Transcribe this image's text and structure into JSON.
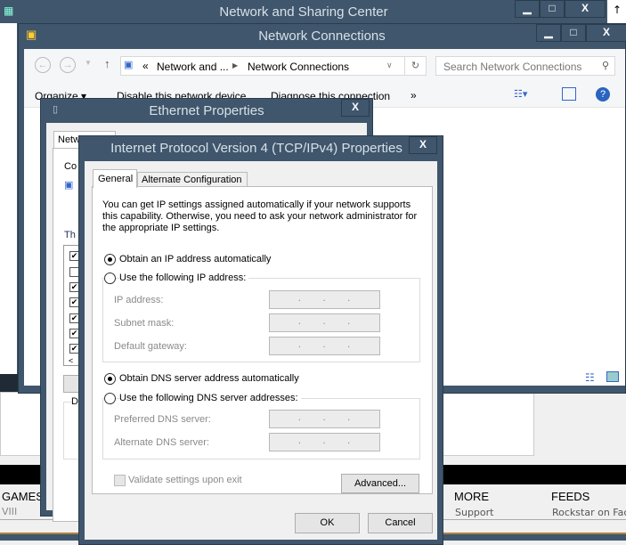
{
  "nsc": {
    "title": "Network and Sharing Center",
    "min": "▁",
    "max": "□",
    "close": "X"
  },
  "nc": {
    "title": "Network Connections",
    "min": "▁",
    "max": "□",
    "close": "X",
    "breadcrumb": [
      "Network and ...",
      "Network Connections"
    ],
    "crumb_prefix": "«",
    "search_placeholder": "Search Network Connections",
    "commands": [
      "Organize ▾",
      "Disable this network device",
      "Diagnose this connection",
      "»"
    ]
  },
  "eth": {
    "title": "Ethernet Properties",
    "close": "X",
    "tab": "Netw",
    "connect_label": "Co",
    "items_label": "Th",
    "scroll_left": "<",
    "group_label": "D"
  },
  "ipv4": {
    "title": "Internet Protocol Version 4 (TCP/IPv4) Properties",
    "close": "X",
    "tabs": [
      "General",
      "Alternate Configuration"
    ],
    "intro": "You can get IP settings assigned automatically if your network supports this capability. Otherwise, you need to ask your network administrator for the appropriate IP settings.",
    "ip_auto": "Obtain an IP address automatically",
    "ip_manual": "Use the following IP address:",
    "ip_fields": [
      "IP address:",
      "Subnet mask:",
      "Default gateway:"
    ],
    "dns_auto": "Obtain DNS server address automatically",
    "dns_manual": "Use the following DNS server addresses:",
    "dns_fields": [
      "Preferred DNS server:",
      "Alternate DNS server:"
    ],
    "validate": "Validate settings upon exit",
    "advanced": "Advanced...",
    "ok": "OK",
    "cancel": "Cancel"
  },
  "background": {
    "games": "GAMES",
    "games_sub": "VIII",
    "more": "MORE",
    "more_sub": "Support",
    "feeds": "FEEDS",
    "feeds_sub": "Rockstar on Face"
  }
}
